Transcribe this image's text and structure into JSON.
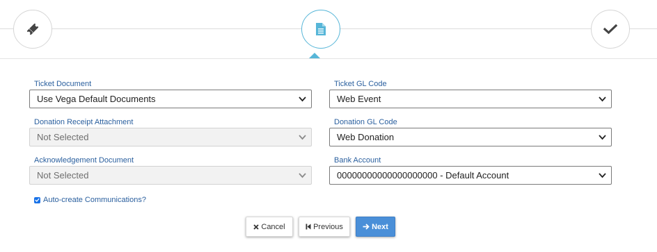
{
  "stepper": {
    "steps": [
      {
        "icon": "ticket-icon",
        "state": "complete"
      },
      {
        "icon": "document-icon",
        "state": "active"
      },
      {
        "icon": "checkmark-icon",
        "state": "pending"
      }
    ],
    "accent_color": "#57b6d8"
  },
  "form": {
    "ticket_document": {
      "label": "Ticket Document",
      "value": "Use Vega Default Documents"
    },
    "ticket_gl_code": {
      "label": "Ticket GL Code",
      "value": "Web Event"
    },
    "donation_receipt_attachment": {
      "label": "Donation Receipt Attachment",
      "value": "Not Selected"
    },
    "donation_gl_code": {
      "label": "Donation GL Code",
      "value": "Web Donation"
    },
    "acknowledgement_document": {
      "label": "Acknowledgement Document",
      "value": "Not Selected"
    },
    "bank_account": {
      "label": "Bank Account",
      "value": "00000000000000000000 - Default Account"
    },
    "auto_create": {
      "label": "Auto-create Communications?",
      "checked": true
    }
  },
  "buttons": {
    "cancel": "Cancel",
    "previous": "Previous",
    "next": "Next"
  }
}
